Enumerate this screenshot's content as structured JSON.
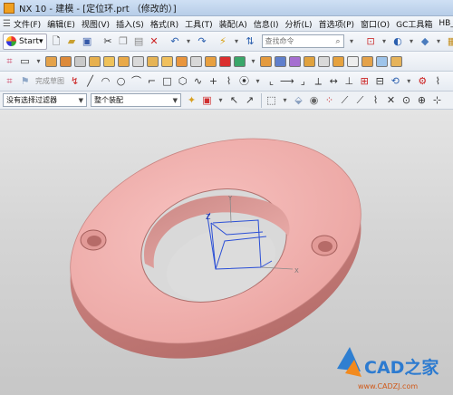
{
  "window": {
    "title": "NX 10 - 建模 - [定位环.prt （修改的）]"
  },
  "menu": {
    "items": [
      "文件(F)",
      "编辑(E)",
      "视图(V)",
      "插入(S)",
      "格式(R)",
      "工具(T)",
      "装配(A)",
      "信息(I)",
      "分析(L)",
      "首选项(P)",
      "窗口(O)",
      "GC工具箱",
      "HB_M"
    ]
  },
  "toolbar_main": {
    "start_label": "Start▾",
    "search_placeholder": "查找命令"
  },
  "toolbar_sketch": {
    "finish_sketch_label": "完成草图"
  },
  "selection_bar": {
    "filter_value": "没有选择过滤器",
    "scope_value": "整个装配"
  },
  "viewport": {
    "coord_label_x": "X",
    "coord_label_y": "Y",
    "coord_label_z": "Z",
    "part_color": "#f0aaa8",
    "part_rim_color": "#cf7f7c"
  },
  "watermark": {
    "brand": "CAD之家",
    "site": "www.CADZJ.com"
  },
  "icons": [
    "nx-app-icon",
    "start-logo",
    "new-file-icon",
    "open-file-icon",
    "save-icon",
    "cut-icon",
    "copy-icon",
    "paste-icon",
    "undo-icon",
    "redo-icon",
    "search-icon",
    "sketch-icon",
    "line-icon",
    "arc-icon",
    "circle-icon",
    "rectangle-icon",
    "snap-icon"
  ]
}
